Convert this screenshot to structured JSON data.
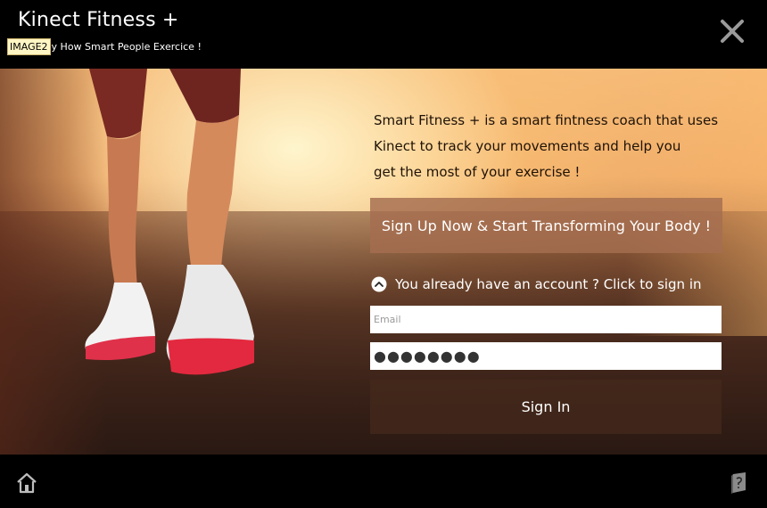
{
  "header": {
    "app_title": "Kinect Fitness +",
    "image_badge": "IMAGE2",
    "tagline": "y How Smart People Exercice !",
    "close_icon": "close-icon"
  },
  "hero": {
    "intro_lines": [
      "Smart Fitness + is a smart fintness coach that uses",
      "Kinect to track your movements and help you",
      "get the most of your exercise !"
    ],
    "signup_label": "Sign Up  Now  & Start Transforming Your Body !",
    "already_label": "You already have an account ? Click to sign in",
    "email_placeholder": "Email",
    "password_value": "●●●●●●●●",
    "signin_label": "Sign In"
  },
  "footer": {
    "home_icon": "home-icon",
    "book_icon": "book-icon"
  },
  "colors": {
    "accent_button": "#a56e50",
    "signin_button": "#462a1c",
    "bar_background": "#000000"
  }
}
